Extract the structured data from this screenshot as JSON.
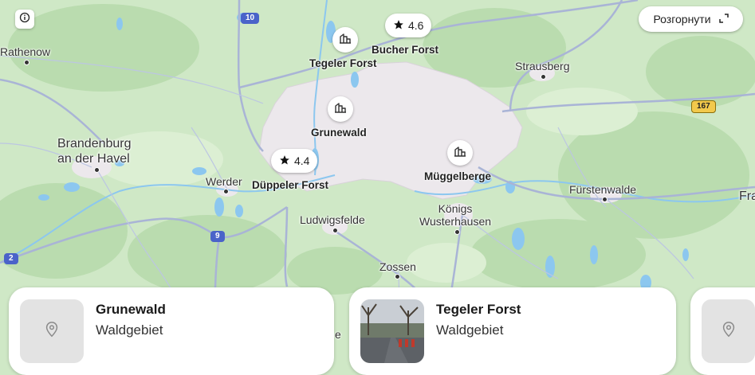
{
  "map": {
    "labels": {
      "rathenow": "Rathenow",
      "brandenburg": "Brandenburg\nan der Havel",
      "werder": "Werder",
      "ludwigsfelde": "Ludwigsfelde",
      "zossen": "Zossen",
      "strausberg": "Strausberg",
      "fuerstenwalde": "Fürstenwalde",
      "koenigs": "Königs\nWusterhausen",
      "fra": "Fra",
      "e_fragment": "e"
    },
    "shields": {
      "r10": "10",
      "r9": "9",
      "r2": "2",
      "r167": "167"
    }
  },
  "pins": {
    "tegeler": {
      "name": "Tegeler Forst",
      "icon": "forest-building-icon"
    },
    "bucher": {
      "name": "Bucher Forst",
      "rating": "4.6",
      "icon": "star-icon"
    },
    "grunewald": {
      "name": "Grunewald",
      "icon": "forest-building-icon"
    },
    "dueppeler": {
      "name": "Düppeler Forst",
      "rating": "4.4",
      "icon": "star-icon"
    },
    "mueggelberge": {
      "name": "Müggelberge",
      "icon": "forest-building-icon"
    }
  },
  "controls": {
    "info_icon": "info-icon",
    "expand_label": "Розгорнути",
    "expand_icon": "expand-icon"
  },
  "cards": [
    {
      "title": "Grunewald",
      "subtitle": "Waldgebiet",
      "thumb": "location-pin-icon"
    },
    {
      "title": "Tegeler Forst",
      "subtitle": "Waldgebiet",
      "thumb": "photo"
    },
    {
      "title": "",
      "subtitle": "",
      "thumb": "location-pin-icon"
    }
  ],
  "colors": {
    "land": "#cfe8c6",
    "forest": "#b9dcae",
    "urban": "#ede9ec",
    "water": "#8cc7ef",
    "road": "#a9b4d6",
    "highway_shield": "#4a63c9",
    "federal_shield": "#f2c94c"
  }
}
